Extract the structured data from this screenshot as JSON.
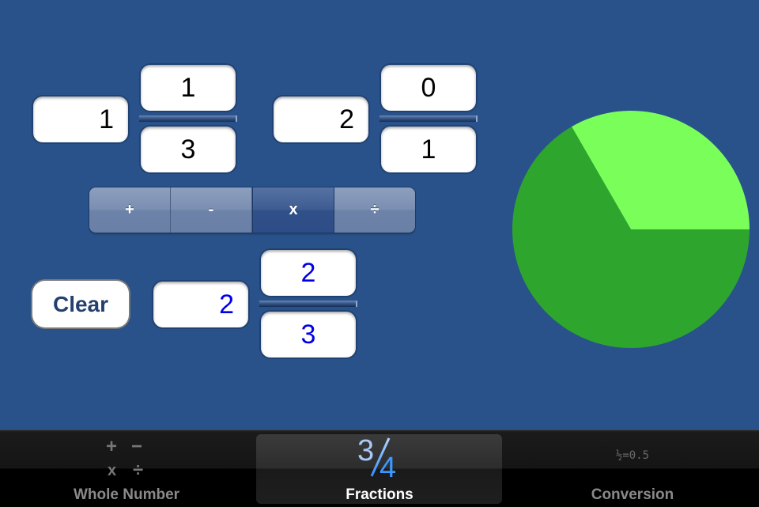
{
  "operand1": {
    "whole": "1",
    "numerator": "1",
    "denominator": "3"
  },
  "operand2": {
    "whole": "2",
    "numerator": "0",
    "denominator": "1"
  },
  "operators": {
    "items": [
      {
        "label": "+",
        "name": "add"
      },
      {
        "label": "-",
        "name": "subtract"
      },
      {
        "label": "x",
        "name": "multiply"
      },
      {
        "label": "÷",
        "name": "divide"
      }
    ],
    "selected": "x"
  },
  "clear_label": "Clear",
  "result": {
    "whole": "2",
    "numerator": "2",
    "denominator": "3"
  },
  "colors": {
    "background": "#29528a",
    "pie_filled": "#2ea62e",
    "pie_remainder": "#7aff5a",
    "result_text": "#0000e6"
  },
  "pie": {
    "fraction_remainder": "1/3",
    "fraction_filled": "2/3"
  },
  "chart_data": {
    "type": "pie",
    "title": "",
    "slices": [
      {
        "label": "fractional part shown (light)",
        "value": 0.3333,
        "color": "#7aff5a"
      },
      {
        "label": "remainder (dark)",
        "value": 0.6667,
        "color": "#2ea62e"
      }
    ]
  },
  "tabbar": {
    "tabs": [
      {
        "label": "Whole Number",
        "icon": "operators-icon",
        "icon_glyphs": [
          "+",
          "−",
          "x",
          "÷"
        ],
        "active": false
      },
      {
        "label": "Fractions",
        "icon": "three-quarters-icon",
        "icon_text": "3/4",
        "active": true
      },
      {
        "label": "Conversion",
        "icon": "half-equals-icon",
        "icon_text": "½=0.5",
        "active": false
      }
    ]
  }
}
